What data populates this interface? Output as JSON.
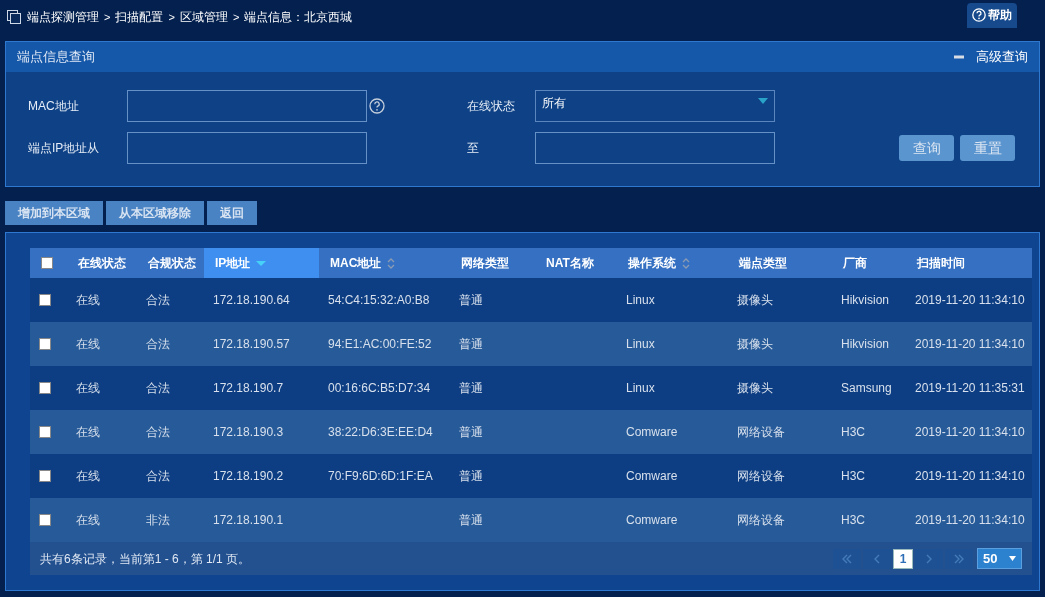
{
  "breadcrumb": {
    "separator": ">",
    "items": [
      "端点探测管理",
      "扫描配置",
      "区域管理",
      "端点信息：北京西城"
    ]
  },
  "help_button": "帮助",
  "query_panel": {
    "title": "端点信息查询",
    "advanced_toggle": "高级查询",
    "expanded": true,
    "fields": [
      {
        "kind": "text",
        "label": "MAC地址",
        "hint_icon": true
      },
      {
        "kind": "select",
        "label": "在线状态",
        "value": "所有"
      },
      {
        "kind": "text",
        "label": "端点IP地址从",
        "hint_icon": false
      },
      {
        "kind": "text",
        "label": "至",
        "hint_icon": false
      }
    ],
    "buttons": [
      "查询",
      "重置"
    ]
  },
  "actions": [
    "增加到本区域",
    "从本区域移除",
    "返回"
  ],
  "table": {
    "select_all": {
      "checked": false
    },
    "columns": [
      {
        "label": "在线状态",
        "sortable": false,
        "sorted": false
      },
      {
        "label": "合规状态",
        "sortable": false,
        "sorted": false
      },
      {
        "label": "IP地址",
        "sortable": true,
        "sorted": true
      },
      {
        "label": "MAC地址",
        "sortable": true,
        "sorted": false
      },
      {
        "label": "网络类型",
        "sortable": false,
        "sorted": false
      },
      {
        "label": "NAT名称",
        "sortable": false,
        "sorted": false
      },
      {
        "label": "操作系统",
        "sortable": true,
        "sorted": false
      },
      {
        "label": "端点类型",
        "sortable": false,
        "sorted": false
      },
      {
        "label": "厂商",
        "sortable": false,
        "sorted": false
      },
      {
        "label": "扫描时间",
        "sortable": false,
        "sorted": false
      }
    ],
    "rows": [
      {
        "checked": false,
        "cells": [
          "在线",
          "合法",
          "172.18.190.64",
          "54:C4:15:32:A0:B8",
          "普通",
          "",
          "Linux",
          "摄像头",
          "Hikvision",
          "2019-11-20 11:34:10"
        ]
      },
      {
        "checked": false,
        "cells": [
          "在线",
          "合法",
          "172.18.190.57",
          "94:E1:AC:00:FE:52",
          "普通",
          "",
          "Linux",
          "摄像头",
          "Hikvision",
          "2019-11-20 11:34:10"
        ]
      },
      {
        "checked": false,
        "cells": [
          "在线",
          "合法",
          "172.18.190.7",
          "00:16:6C:B5:D7:34",
          "普通",
          "",
          "Linux",
          "摄像头",
          "Samsung",
          "2019-11-20 11:35:31"
        ]
      },
      {
        "checked": false,
        "cells": [
          "在线",
          "合法",
          "172.18.190.3",
          "38:22:D6:3E:EE:D4",
          "普通",
          "",
          "Comware",
          "网络设备",
          "H3C",
          "2019-11-20 11:34:10"
        ]
      },
      {
        "checked": false,
        "cells": [
          "在线",
          "合法",
          "172.18.190.2",
          "70:F9:6D:6D:1F:EA",
          "普通",
          "",
          "Comware",
          "网络设备",
          "H3C",
          "2019-11-20 11:34:10"
        ]
      },
      {
        "checked": false,
        "cells": [
          "在线",
          "非法",
          "172.18.190.1",
          "",
          "普通",
          "",
          "Comware",
          "网络设备",
          "H3C",
          "2019-11-20 11:34:10"
        ]
      }
    ]
  },
  "footer": {
    "summary": "共有6条记录，当前第1 - 6，第 1/1 页。",
    "pages": [
      {
        "kind": "first",
        "disabled": true
      },
      {
        "kind": "prev",
        "disabled": true
      },
      {
        "kind": "page",
        "label": "1",
        "selected": true
      },
      {
        "kind": "next",
        "disabled": true
      },
      {
        "kind": "last",
        "disabled": true
      }
    ],
    "page_size": "50"
  }
}
